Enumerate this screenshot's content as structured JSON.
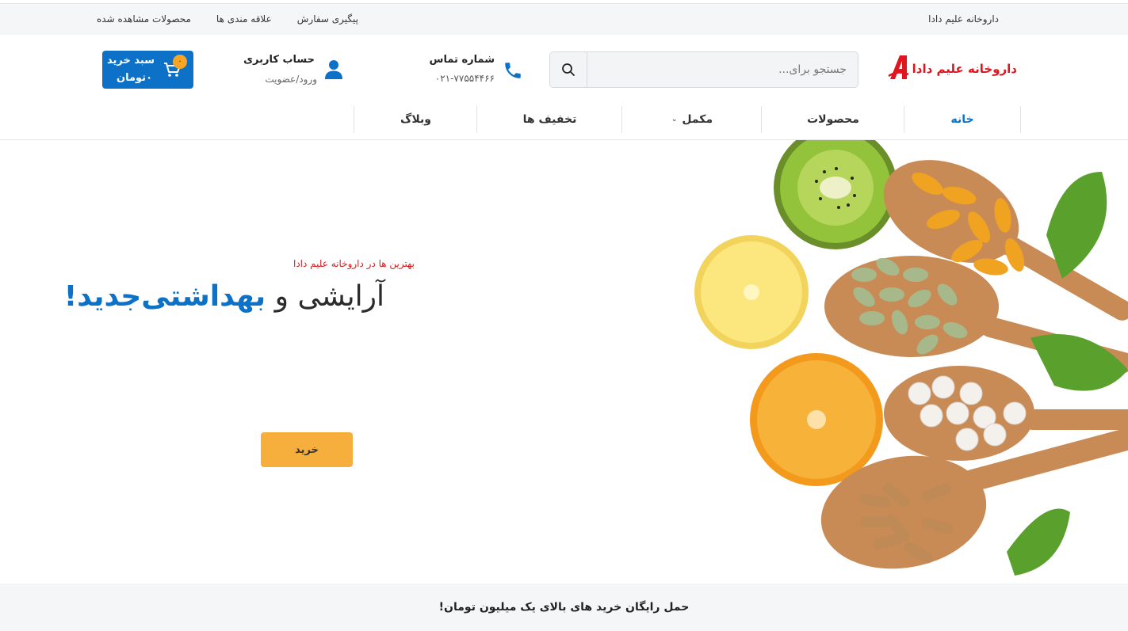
{
  "topbar": {
    "brand": "داروخانه علیم دادا",
    "links": [
      "محصولات مشاهده شده",
      "علاقه مندی ها",
      "پیگیری سفارش"
    ]
  },
  "header": {
    "logo_text": "داروخانه علیم دادا",
    "search": {
      "placeholder": "جستجو برای..."
    },
    "contact": {
      "title": "شماره تماس",
      "phone": "۰۲۱-۷۷۵۵۴۴۶۶"
    },
    "account": {
      "title": "حساب کاربری",
      "subtitle": "ورود/عضویت"
    },
    "cart": {
      "title": "سبد خرید",
      "amount": "۰تومان",
      "count": "۰"
    }
  },
  "nav": {
    "items": [
      {
        "label": "خانه"
      },
      {
        "label": "محصولات"
      },
      {
        "label": "مکمل"
      },
      {
        "label": "تخفیف ها"
      },
      {
        "label": "وبلاگ"
      }
    ]
  },
  "hero": {
    "tagline": "بهترین ها در داروخانه علیم دادا",
    "headline_part1": "آرایشی و ",
    "headline_part2": "بهداشتی‌جدید!",
    "button": "خرید"
  },
  "footer": {
    "notice": "حمل رایگان خرید های بالای یک میلیون تومان!"
  },
  "colors": {
    "accent": "#0d72c7",
    "brand_red": "#e0151f",
    "button": "#f6ae3c"
  }
}
